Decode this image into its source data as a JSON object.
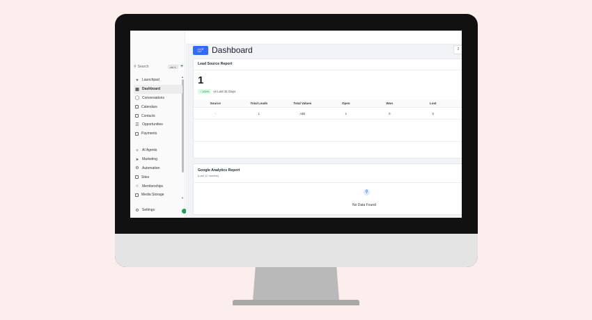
{
  "page": {
    "title": "Dashboard",
    "date_stub": "2"
  },
  "sidebar": {
    "search_placeholder": "Search",
    "search_shortcut": "ctrl K",
    "items": [
      {
        "label": "Launchpad",
        "icon": "rocket-icon"
      },
      {
        "label": "Dashboard",
        "icon": "grid-icon",
        "active": true
      },
      {
        "label": "Conversations",
        "icon": "chat-icon"
      },
      {
        "label": "Calendars",
        "icon": "calendar-icon"
      },
      {
        "label": "Contacts",
        "icon": "contacts-icon"
      },
      {
        "label": "Opportunities",
        "icon": "filter-icon"
      },
      {
        "label": "Payments",
        "icon": "payments-icon"
      }
    ],
    "items2": [
      {
        "label": "AI Agents",
        "icon": "sparkle-icon"
      },
      {
        "label": "Marketing",
        "icon": "send-icon"
      },
      {
        "label": "Automation",
        "icon": "automation-icon"
      },
      {
        "label": "Sites",
        "icon": "sites-icon"
      },
      {
        "label": "Memberships",
        "icon": "membership-icon"
      },
      {
        "label": "Media Storage",
        "icon": "media-icon"
      }
    ],
    "settings_label": "Settings"
  },
  "lead_source": {
    "title": "Lead Source Report",
    "total": "1",
    "change_badge": "↑ 100%",
    "change_text": "vs Last 31 Days",
    "columns": [
      "Source",
      "Total Leads",
      "Total Values",
      "Open",
      "Won",
      "Lost"
    ],
    "rows": [
      [
        "-",
        "1",
        "A$0",
        "1",
        "0",
        "0"
      ]
    ]
  },
  "analytics": {
    "title": "Google Analytics Report",
    "subtitle": "(Last 12 months)",
    "empty_text": "No Data Found"
  }
}
